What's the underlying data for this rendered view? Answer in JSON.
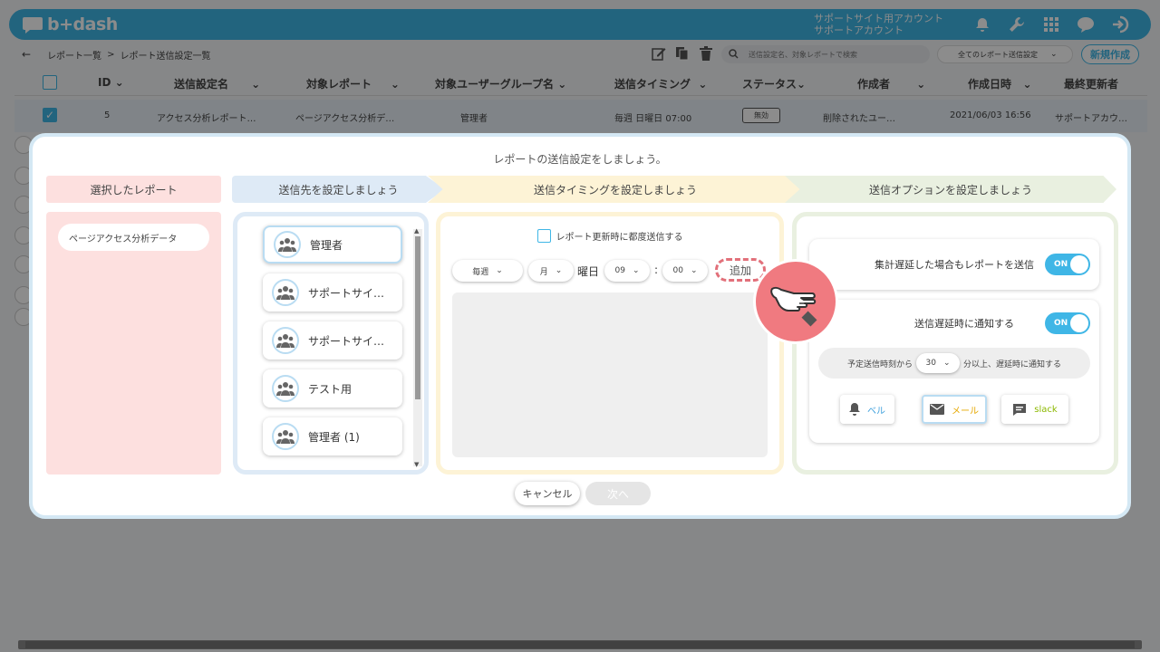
{
  "header": {
    "logo_text": "b+dash",
    "account_line1": "サポートサイト用アカウント",
    "account_line2": "サポートアカウント",
    "icons": [
      "bell-icon",
      "wrench-icon",
      "grid-icon",
      "chat-icon",
      "logout-icon"
    ]
  },
  "subbar": {
    "back": "←",
    "crumb1": "レポート一覧",
    "crumb_sep": ">",
    "crumb2": "レポート送信設定一覧",
    "search_placeholder": "送信設定名、対象レポートで検索",
    "filter_label": "全てのレポート送信設定",
    "new_button": "新規作成"
  },
  "table": {
    "headers": [
      "ID",
      "送信設定名",
      "対象レポート",
      "対象ユーザーグループ名",
      "送信タイミング",
      "ステータス",
      "作成者",
      "作成日時",
      "最終更新者"
    ],
    "row": {
      "id": "5",
      "name": "アクセス分析レポート…",
      "report": "ページアクセス分析デ…",
      "group": "管理者",
      "timing": "毎週 日曜日 07:00",
      "status": "無効",
      "creator": "削除されたユー…",
      "created": "2021/06/03 16:56",
      "updater": "サポートアカウ…"
    }
  },
  "modal": {
    "title": "レポートの送信設定をしましょう。",
    "steps": [
      "選択したレポート",
      "送信先を設定しましょう",
      "送信タイミングを設定しましょう",
      "送信オプションを設定しましょう"
    ],
    "selected_report": "ページアクセス分析データ",
    "groups": [
      "管理者",
      "サポートサイ…",
      "サポートサイ…",
      "テスト用",
      "管理者 (1)"
    ],
    "timing": {
      "every_update_label": "レポート更新時に都度送信する",
      "frequency": "毎週",
      "weekday": "月",
      "weekday_suffix": "曜日",
      "hour": "09",
      "colon": ":",
      "minute": "00",
      "add_button": "追加"
    },
    "options": {
      "delay_send_label": "集計遅延した場合もレポートを送信",
      "delay_send_toggle": "ON",
      "notify_label": "送信遅延時に通知する",
      "notify_toggle": "ON",
      "delay_prefix": "予定送信時刻から",
      "delay_minutes": "30",
      "delay_suffix": "分以上、遅延時に通知する",
      "notify_bell": "ベル",
      "notify_mail": "メール",
      "notify_slack": "slack"
    },
    "cancel_button": "キャンセル",
    "next_button": "次へ"
  },
  "colors": {
    "primary": "#3fb6e6",
    "highlight": "#e2707a",
    "bell": "#3fa0dc",
    "mail": "#e6a800",
    "slack": "#8cb800"
  }
}
